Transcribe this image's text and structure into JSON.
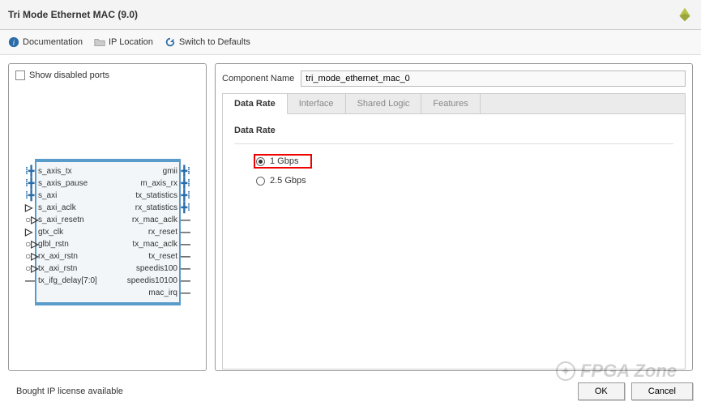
{
  "header": {
    "title": "Tri Mode Ethernet MAC (9.0)"
  },
  "toolbar": {
    "documentation": "Documentation",
    "ip_location": "IP Location",
    "switch_defaults": "Switch to Defaults"
  },
  "left_panel": {
    "show_disabled": "Show disabled ports",
    "ports_left": [
      {
        "name": "s_axis_tx",
        "marker": "plus-bus"
      },
      {
        "name": "s_axis_pause",
        "marker": "plus-bus"
      },
      {
        "name": "s_axi",
        "marker": "plus-bus"
      },
      {
        "name": "s_axi_aclk",
        "marker": "tri"
      },
      {
        "name": "s_axi_resetn",
        "marker": "tri-inv"
      },
      {
        "name": "gtx_clk",
        "marker": "tri"
      },
      {
        "name": "glbl_rstn",
        "marker": "tri-inv"
      },
      {
        "name": "rx_axi_rstn",
        "marker": "tri-inv"
      },
      {
        "name": "tx_axi_rstn",
        "marker": "tri-inv"
      },
      {
        "name": "tx_ifg_delay[7:0]",
        "marker": "line"
      }
    ],
    "ports_right": [
      {
        "name": "gmii",
        "marker": "plus-bus"
      },
      {
        "name": "m_axis_rx",
        "marker": "plus-bus"
      },
      {
        "name": "tx_statistics",
        "marker": "plus-bus"
      },
      {
        "name": "rx_statistics",
        "marker": "plus-bus"
      },
      {
        "name": "rx_mac_aclk",
        "marker": "line"
      },
      {
        "name": "rx_reset",
        "marker": "line"
      },
      {
        "name": "tx_mac_aclk",
        "marker": "line"
      },
      {
        "name": "tx_reset",
        "marker": "line"
      },
      {
        "name": "speedis100",
        "marker": "line"
      },
      {
        "name": "speedis10100",
        "marker": "line"
      },
      {
        "name": "mac_irq",
        "marker": "line"
      }
    ]
  },
  "right_panel": {
    "comp_label": "Component Name",
    "comp_value": "tri_mode_ethernet_mac_0",
    "tabs": [
      "Data Rate",
      "Interface",
      "Shared Logic",
      "Features"
    ],
    "active_tab": 0,
    "section_title": "Data Rate",
    "radios": [
      {
        "label": "1 Gbps",
        "checked": true,
        "highlight": true
      },
      {
        "label": "2.5 Gbps",
        "checked": false,
        "highlight": false
      }
    ]
  },
  "footer": {
    "status": "Bought IP license available",
    "ok": "OK",
    "cancel": "Cancel"
  },
  "watermark": "FPGA Zone"
}
